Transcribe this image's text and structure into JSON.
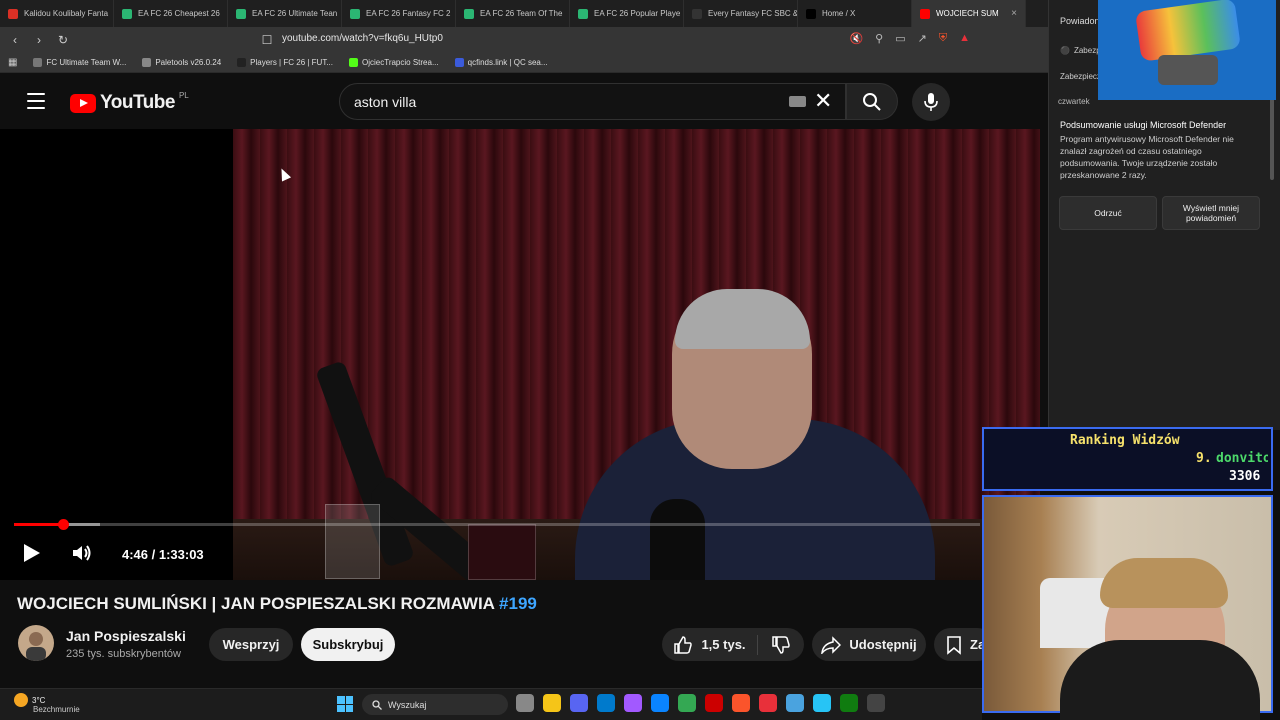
{
  "browser": {
    "tabs": [
      {
        "label": "Kalidou Koulibaly Fanta",
        "color": "#d93025"
      },
      {
        "label": "EA FC 26 Cheapest 26",
        "color": "#2bb673"
      },
      {
        "label": "EA FC 26 Ultimate Tean",
        "color": "#2bb673"
      },
      {
        "label": "EA FC 26 Fantasy FC 2",
        "color": "#2bb673"
      },
      {
        "label": "EA FC 26 Team Of The",
        "color": "#2bb673"
      },
      {
        "label": "EA FC 26 Popular Playe",
        "color": "#2bb673"
      },
      {
        "label": "Every Fantasy FC SBC &",
        "color": "#333333"
      },
      {
        "label": "Home / X",
        "color": "#000000"
      },
      {
        "label": "WOJCIECH SUM",
        "color": "#ff0000",
        "active": true
      }
    ],
    "url": "youtube.com/watch?v=fkq6u_HUtp0",
    "bookmarks": [
      {
        "label": "FC Ultimate Team W...",
        "color": "#777777"
      },
      {
        "label": "Paletools v26.0.24",
        "color": "#888888"
      },
      {
        "label": "Players | FC 26 | FUT...",
        "color": "#222222"
      },
      {
        "label": "OjciecTrapcio Strea...",
        "color": "#53fc18"
      },
      {
        "label": "qcfinds.link | QC sea...",
        "color": "#3b5bdb"
      }
    ]
  },
  "youtube": {
    "logo_text": "YouTube",
    "country": "PL",
    "search_value": "aston villa",
    "video": {
      "current_time": "4:46",
      "duration": "1:33:03",
      "time_display": "4:46 / 1:33:03",
      "played_fraction": 0.051,
      "buffered_fraction": 0.089
    },
    "title_main": "WOJCIECH SUMLIŃSKI | JAN POSPIESZALSKI ROZMAWIA ",
    "title_tag": "#199",
    "channel": {
      "name": "Jan Pospieszalski",
      "subscribers": "235 tys. subskrybentów"
    },
    "buttons": {
      "support": "Wesprzyj",
      "subscribe": "Subskrybuj",
      "likes": "1,5 tys.",
      "share": "Udostępnij",
      "save": "Za"
    }
  },
  "notifications": {
    "header": "Powiadon",
    "row1": "Zabezpi",
    "row2": "Zabezpiecz",
    "day": "czwartek",
    "title": "Podsumowanie usługi Microsoft Defender",
    "body": "Program antywirusowy Microsoft Defender nie znalazł zagrożeń od czasu ostatniego podsumowania. Twoje urządzenie zostało przeskanowane 2 razy.",
    "dismiss": "Odrzuć",
    "show_less": "Wyświetl mniej powiadomień"
  },
  "ranking": {
    "title": "Ranking Widzów",
    "position": "9.",
    "name": "donvito",
    "score": "3306"
  },
  "taskbar": {
    "temperature": "3°C",
    "condition": "Bezchmurnie",
    "search_placeholder": "Wyszukaj",
    "icons": [
      "#888888",
      "#f5c518",
      "#5865f2",
      "#007acc",
      "#a259ff",
      "#0a84ff",
      "#34a853",
      "#cc0000",
      "#fb542b",
      "#e8303a",
      "#4aa3df",
      "#27c4f5",
      "#107c10",
      "#444444"
    ]
  }
}
